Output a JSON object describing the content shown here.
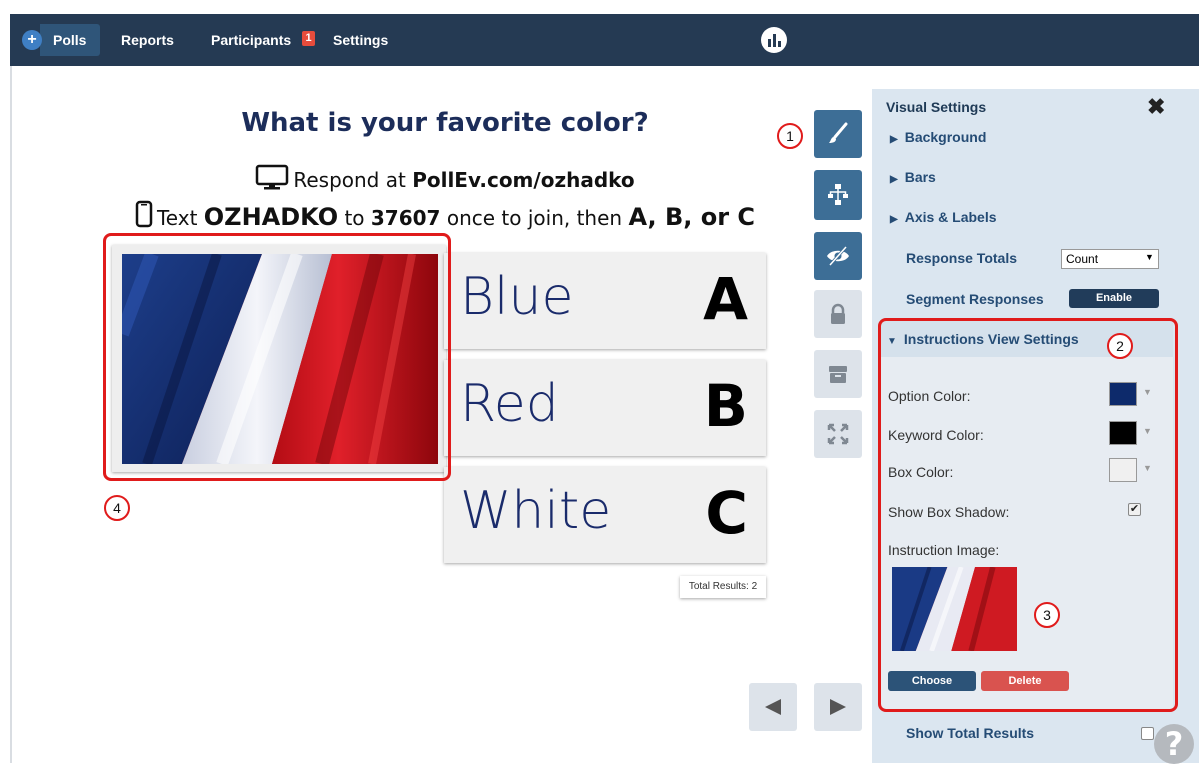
{
  "nav": {
    "plus": "+",
    "polls": "Polls",
    "reports": "Reports",
    "participants": "Participants",
    "participants_badge": "1",
    "settings": "Settings"
  },
  "poll": {
    "title": "What is your favorite color?",
    "respond_prefix": "Respond at ",
    "respond_url": "PollEv.com/ozhadko",
    "text_prefix": "Text ",
    "keyword": "OZHADKO",
    "text_to": " to ",
    "number": "37607",
    "text_suffix": " once to join, then ",
    "options_hint": "A, B, or C",
    "options": [
      {
        "label": "Blue",
        "key": "A"
      },
      {
        "label": "Red",
        "key": "B"
      },
      {
        "label": "White",
        "key": "C"
      }
    ],
    "total_results": "Total Results: 2"
  },
  "annotations": [
    "1",
    "2",
    "3",
    "4"
  ],
  "panel": {
    "title": "Visual Settings",
    "close": "✖",
    "sections": {
      "background": "Background",
      "bars": "Bars",
      "axis": "Axis & Labels"
    },
    "response_totals": {
      "label": "Response Totals",
      "value": "Count"
    },
    "segment_responses": {
      "label": "Segment Responses",
      "button": "Enable"
    },
    "instructions": {
      "title": "Instructions View Settings",
      "option_color_label": "Option Color:",
      "keyword_color_label": "Keyword Color:",
      "box_color_label": "Box Color:",
      "show_box_shadow_label": "Show Box Shadow:",
      "show_box_shadow_checked": true,
      "instruction_image_label": "Instruction Image:",
      "choose": "Choose",
      "delete": "Delete",
      "colors": {
        "option": "#0d2a6b",
        "keyword": "#000000",
        "box": "#f0f0f0"
      }
    },
    "show_total_results": "Show Total Results"
  },
  "help": "?",
  "icons": [
    "paintbrush-icon",
    "flowchart-icon",
    "eye-slash-icon",
    "lock-icon",
    "archive-icon",
    "fullscreen-icon",
    "prev-arrow-icon",
    "next-arrow-icon",
    "monitor-icon",
    "phone-icon",
    "logo-icon"
  ]
}
